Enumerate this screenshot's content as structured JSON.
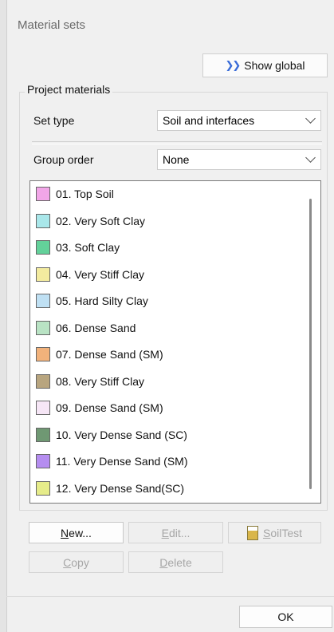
{
  "window": {
    "title": "Material sets"
  },
  "toolbar": {
    "show_global_label": "Show global"
  },
  "project_materials": {
    "label": "Project materials",
    "set_type": {
      "label": "Set type",
      "value": "Soil and interfaces"
    },
    "group_order": {
      "label": "Group order",
      "value": "None"
    }
  },
  "materials": [
    {
      "label": "01. Top Soil",
      "color": "#f2a6e8"
    },
    {
      "label": "02. Very Soft Clay",
      "color": "#a9e7ea"
    },
    {
      "label": "03. Soft Clay",
      "color": "#63d19a"
    },
    {
      "label": "04. Very Stiff Clay",
      "color": "#f3eb9f"
    },
    {
      "label": "05. Hard Silty Clay",
      "color": "#bfe0f3"
    },
    {
      "label": "06. Dense Sand",
      "color": "#b9e3c4"
    },
    {
      "label": "07. Dense Sand (SM)",
      "color": "#f2b27b"
    },
    {
      "label": "08. Very Stiff Clay",
      "color": "#b8a57f"
    },
    {
      "label": "09. Dense Sand (SM)",
      "color": "#f6e6f6"
    },
    {
      "label": "10. Very Dense Sand (SC)",
      "color": "#6f9873"
    },
    {
      "label": "11. Very Dense Sand (SM)",
      "color": "#b58df0"
    },
    {
      "label": "12. Very Dense Sand(SC)",
      "color": "#e6ec8a"
    }
  ],
  "buttons": {
    "new": {
      "mnemonic": "N",
      "rest": "ew..."
    },
    "edit": {
      "mnemonic": "E",
      "rest": "dit..."
    },
    "soiltest": {
      "mnemonic": "S",
      "rest": "oilTest"
    },
    "copy": {
      "mnemonic": "C",
      "rest": "opy"
    },
    "delete": {
      "mnemonic": "D",
      "rest": "elete"
    },
    "ok": {
      "label": "OK"
    }
  }
}
